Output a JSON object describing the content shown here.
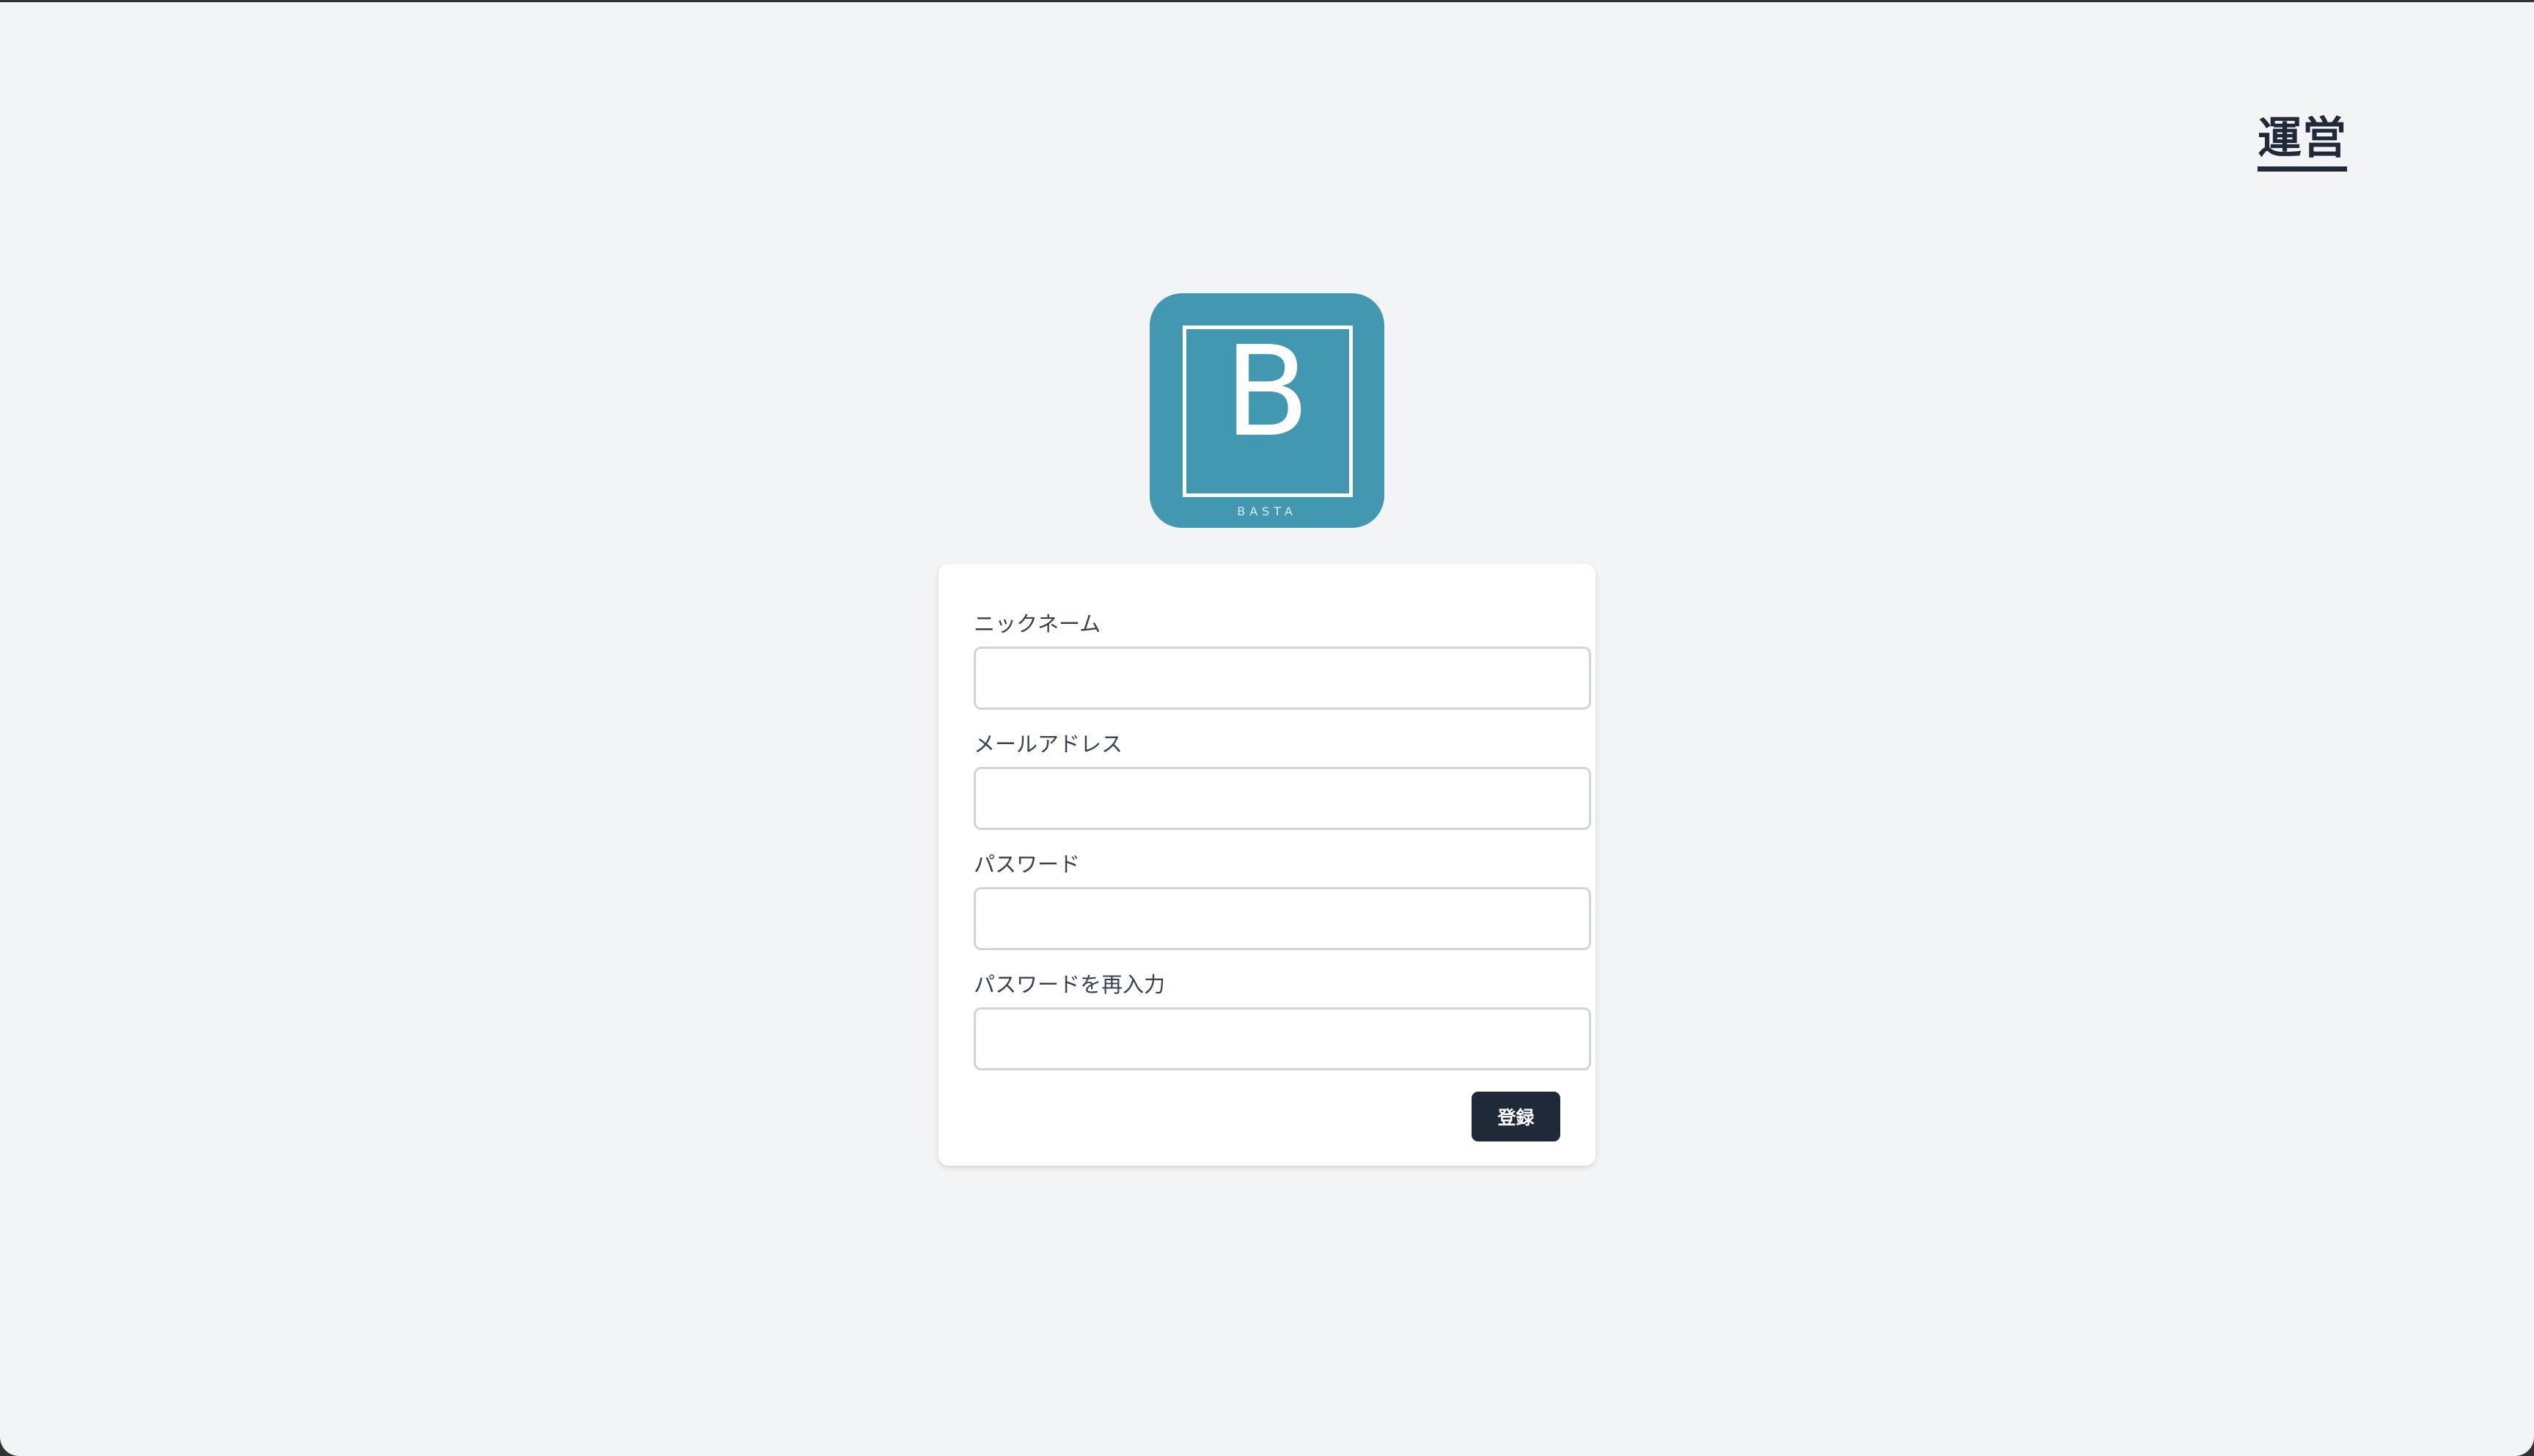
{
  "header": {
    "link_label": "運営"
  },
  "logo": {
    "letter": "B",
    "caption": "BASTA",
    "color": "#4297b1"
  },
  "form": {
    "fields": [
      {
        "label": "ニックネーム",
        "value": "",
        "placeholder": ""
      },
      {
        "label": "メールアドレス",
        "value": "",
        "placeholder": ""
      },
      {
        "label": "パスワード",
        "value": "",
        "placeholder": ""
      },
      {
        "label": "パスワードを再入力",
        "value": "",
        "placeholder": ""
      }
    ],
    "submit_label": "登録"
  },
  "colors": {
    "background": "#f3f4f6",
    "primary_button": "#1f2937",
    "text": "#374151"
  }
}
